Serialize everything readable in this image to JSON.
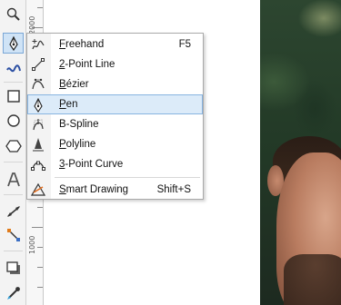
{
  "toolbox": {
    "tools": [
      "zoom-tool",
      "freehand-pen-tool",
      "smart-fill-tool",
      "rectangle-tool",
      "ellipse-tool",
      "polygon-tool",
      "text-tool",
      "dimension-tool",
      "connector-tool",
      "drop-shadow-tool",
      "eyedropper-tool",
      "fill-tool"
    ],
    "active_tool": "freehand-pen-tool"
  },
  "ruler": {
    "labels": [
      "2000",
      "1000"
    ]
  },
  "flyout_menu": {
    "items": [
      {
        "id": "freehand",
        "label": "Freehand",
        "shortcut": "F5",
        "icon": "freehand-icon"
      },
      {
        "id": "two-point-line",
        "label": "2-Point Line",
        "shortcut": "",
        "icon": "two-point-line-icon"
      },
      {
        "id": "bezier",
        "label": "Bézier",
        "shortcut": "",
        "icon": "bezier-icon"
      },
      {
        "id": "pen",
        "label": "Pen",
        "shortcut": "",
        "icon": "pen-icon",
        "selected": true
      },
      {
        "id": "b-spline",
        "label": "B-Spline",
        "shortcut": "",
        "icon": "b-spline-icon"
      },
      {
        "id": "polyline",
        "label": "Polyline",
        "shortcut": "",
        "icon": "polyline-icon"
      },
      {
        "id": "three-point-curve",
        "label": "3-Point Curve",
        "shortcut": "",
        "icon": "three-point-curve-icon"
      },
      {
        "id": "smart-drawing",
        "label": "Smart Drawing",
        "shortcut": "Shift+S",
        "icon": "smart-drawing-icon"
      }
    ]
  },
  "colors": {
    "selection_bg": "#dcebf9",
    "selection_border": "#88b4e0",
    "active_tool_bg": "#cfe3f6"
  }
}
